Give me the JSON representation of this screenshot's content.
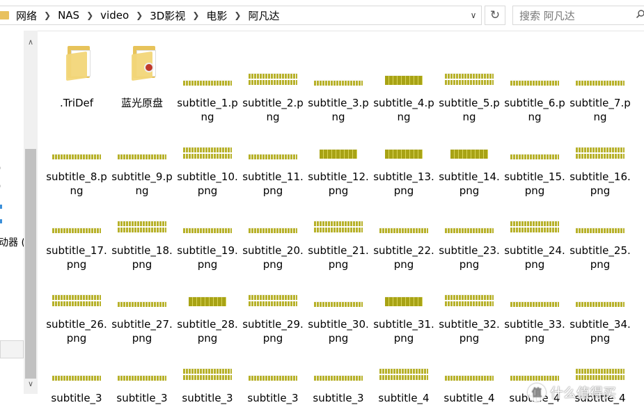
{
  "breadcrumb": [
    "网络",
    "NAS",
    "video",
    "3D影视",
    "电影",
    "阿凡达"
  ],
  "search": {
    "placeholder": "搜索 阿凡达"
  },
  "nav": {
    "fragments": [
      ")",
      ")",
      "动器 ("
    ]
  },
  "folders": [
    {
      "name": ".TriDef"
    },
    {
      "name": "蓝光原盘"
    }
  ],
  "files": [
    "subtitle_1.png",
    "subtitle_2.png",
    "subtitle_3.png",
    "subtitle_4.png",
    "subtitle_5.png",
    "subtitle_6.png",
    "subtitle_7.png",
    "subtitle_8.png",
    "subtitle_9.png",
    "subtitle_10.png",
    "subtitle_11.png",
    "subtitle_12.png",
    "subtitle_13.png",
    "subtitle_14.png",
    "subtitle_15.png",
    "subtitle_16.png",
    "subtitle_17.png",
    "subtitle_18.png",
    "subtitle_19.png",
    "subtitle_20.png",
    "subtitle_21.png",
    "subtitle_22.png",
    "subtitle_23.png",
    "subtitle_24.png",
    "subtitle_25.png",
    "subtitle_26.png",
    "subtitle_27.png",
    "subtitle_28.png",
    "subtitle_29.png",
    "subtitle_30.png",
    "subtitle_31.png",
    "subtitle_32.png",
    "subtitle_33.png",
    "subtitle_34.png",
    "subtitle_3",
    "subtitle_3",
    "subtitle_3",
    "subtitle_3",
    "subtitle_3",
    "subtitle_4",
    "subtitle_4",
    "subtitle_4",
    "subtitle_4"
  ],
  "thumb_text": {
    "subtitle_4.png": "自由自在",
    "subtitle_12.png": "我们到了吗",
    "subtitle_13.png": "是的，我们到了",
    "subtitle_14.png": "我们到了",
    "subtitle_28.png": "就像这样",
    "subtitle_31.png": "非常不错"
  },
  "watermark": {
    "text": "什么值得买",
    "logo": "值"
  },
  "colors": {
    "folder": "#e7c35a",
    "subtitle_text": "#b7b12a",
    "accent": "#3b8fd9"
  }
}
